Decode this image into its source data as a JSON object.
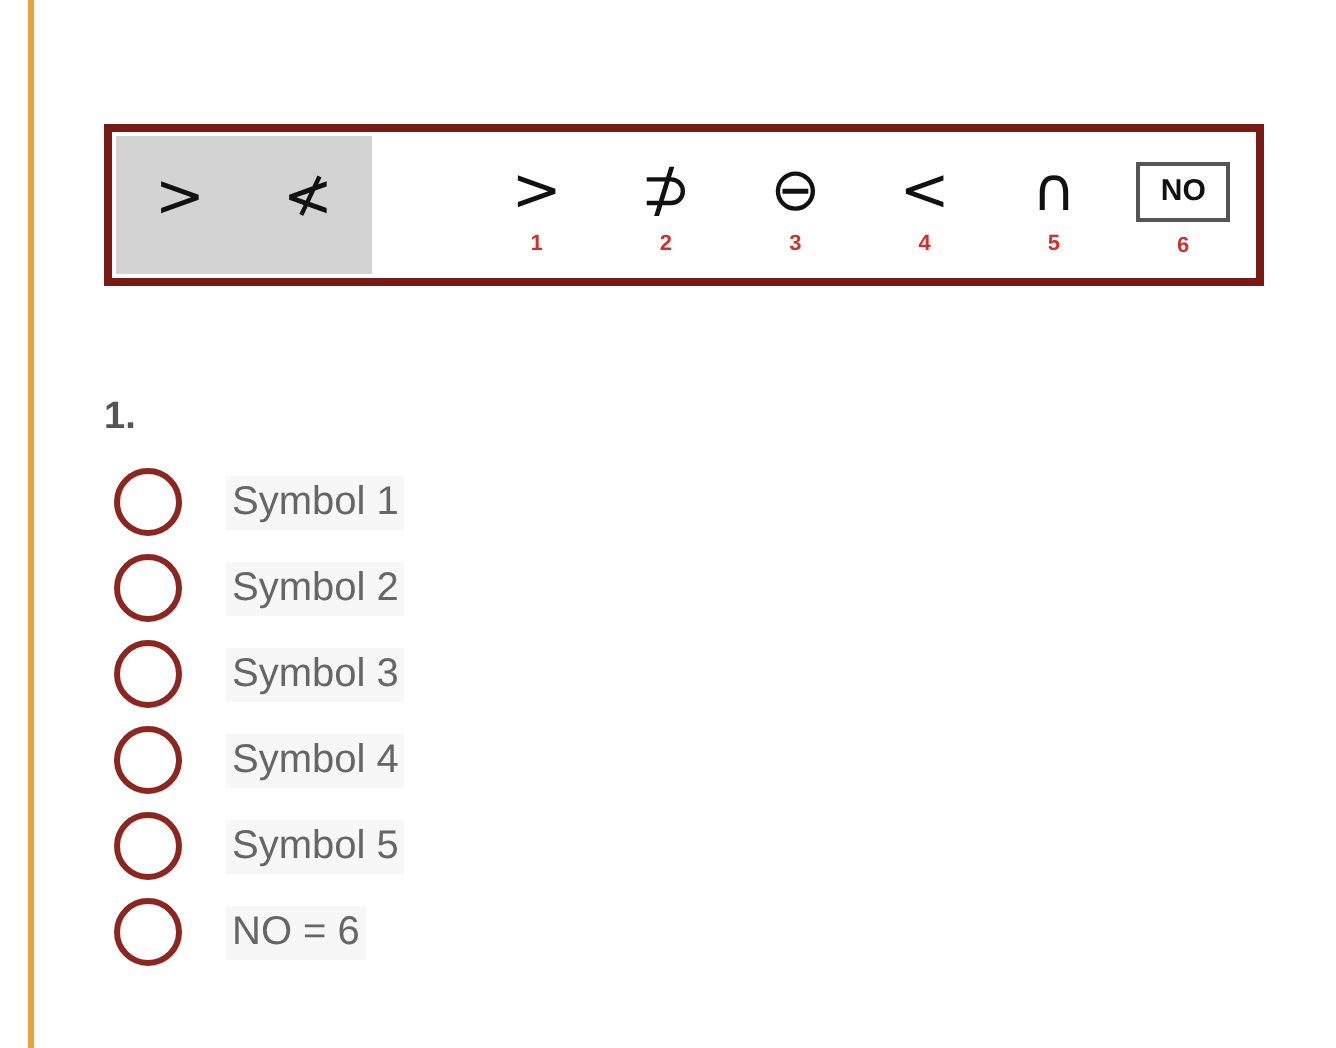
{
  "puzzle": {
    "given": [
      ">",
      "≮"
    ],
    "choices": [
      {
        "symbol": ">",
        "number": "1",
        "kind": "glyph"
      },
      {
        "symbol": "⊅",
        "number": "2",
        "kind": "glyph"
      },
      {
        "symbol": "⊖",
        "number": "3",
        "kind": "glyph"
      },
      {
        "symbol": "<",
        "number": "4",
        "kind": "glyph"
      },
      {
        "symbol": "∩",
        "number": "5",
        "kind": "glyph"
      },
      {
        "symbol": "NO",
        "number": "6",
        "kind": "boxed"
      }
    ]
  },
  "question": {
    "number": "1.",
    "options": [
      {
        "label": "Symbol 1",
        "selected": false
      },
      {
        "label": "Symbol 2",
        "selected": false
      },
      {
        "label": "Symbol 3",
        "selected": false
      },
      {
        "label": "Symbol 4",
        "selected": false
      },
      {
        "label": "Symbol 5",
        "selected": false
      },
      {
        "label": "NO = 6",
        "selected": false
      }
    ]
  }
}
